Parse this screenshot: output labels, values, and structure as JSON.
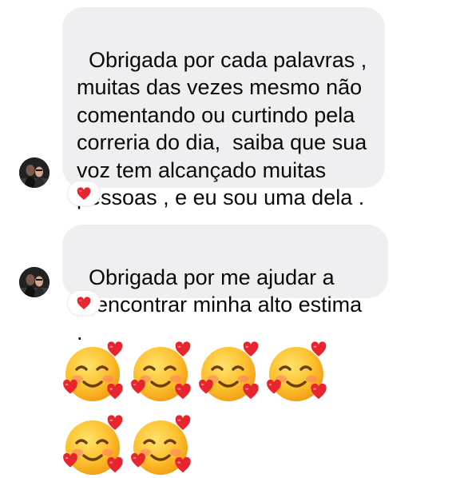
{
  "conversation": {
    "messages": [
      {
        "text": "Obrigada por cada palavras ,\nmuitas das vezes mesmo não\ncomentando ou curtindo pela\ncorreria do dia,  saiba que sua\nvoz tem alcançado muitas\npessoas , e eu sou uma dela .",
        "reaction": "red-heart-icon"
      },
      {
        "text": "Obrigada por me ajudar a\nreencontrar minha alto estima .",
        "reaction": "red-heart-icon"
      }
    ],
    "emoji_message": {
      "emoji": "smiling-face-with-hearts-icon",
      "count": 6
    }
  },
  "colors": {
    "bubble_background": "#efeff1",
    "text": "#0a0a0a",
    "heart": "#e8252f",
    "emoji_face": "#fbc02d"
  }
}
